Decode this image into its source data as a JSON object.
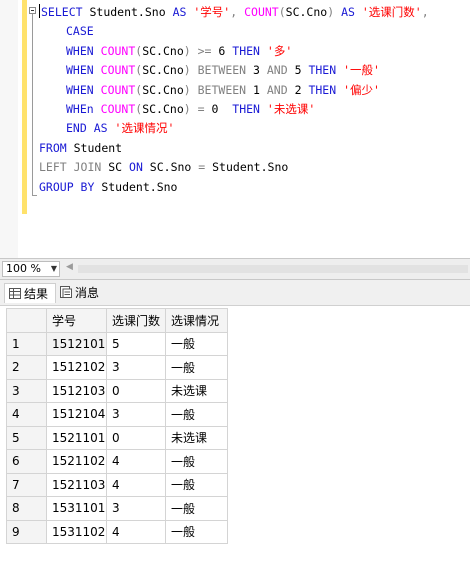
{
  "editor": {
    "lines": [
      [
        {
          "t": "kw",
          "v": "SELECT"
        },
        {
          "t": "txt",
          "v": " Student.Sno "
        },
        {
          "t": "kw",
          "v": "AS"
        },
        {
          "t": "txt",
          "v": " "
        },
        {
          "t": "str",
          "v": "'学号'"
        },
        {
          "t": "gr",
          "v": ","
        },
        {
          "t": "txt",
          "v": " "
        },
        {
          "t": "fn",
          "v": "COUNT"
        },
        {
          "t": "gr",
          "v": "("
        },
        {
          "t": "txt",
          "v": "SC.Cno"
        },
        {
          "t": "gr",
          "v": ")"
        },
        {
          "t": "txt",
          "v": " "
        },
        {
          "t": "kw",
          "v": "AS"
        },
        {
          "t": "txt",
          "v": " "
        },
        {
          "t": "str",
          "v": "'选课门数'"
        },
        {
          "t": "gr",
          "v": ","
        }
      ],
      [
        {
          "t": "kw",
          "v": "CASE"
        }
      ],
      [
        {
          "t": "kw",
          "v": "WHEN"
        },
        {
          "t": "txt",
          "v": " "
        },
        {
          "t": "fn",
          "v": "COUNT"
        },
        {
          "t": "gr",
          "v": "("
        },
        {
          "t": "txt",
          "v": "SC.Cno"
        },
        {
          "t": "gr",
          "v": ")"
        },
        {
          "t": "txt",
          "v": " "
        },
        {
          "t": "gr",
          "v": ">="
        },
        {
          "t": "txt",
          "v": " 6 "
        },
        {
          "t": "kw",
          "v": "THEN"
        },
        {
          "t": "txt",
          "v": " "
        },
        {
          "t": "str",
          "v": "'多'"
        }
      ],
      [
        {
          "t": "kw",
          "v": "WHEN"
        },
        {
          "t": "txt",
          "v": " "
        },
        {
          "t": "fn",
          "v": "COUNT"
        },
        {
          "t": "gr",
          "v": "("
        },
        {
          "t": "txt",
          "v": "SC.Cno"
        },
        {
          "t": "gr",
          "v": ")"
        },
        {
          "t": "txt",
          "v": " "
        },
        {
          "t": "gr",
          "v": "BETWEEN"
        },
        {
          "t": "txt",
          "v": " 3 "
        },
        {
          "t": "gr",
          "v": "AND"
        },
        {
          "t": "txt",
          "v": " 5 "
        },
        {
          "t": "kw",
          "v": "THEN"
        },
        {
          "t": "txt",
          "v": " "
        },
        {
          "t": "str",
          "v": "'一般'"
        }
      ],
      [
        {
          "t": "kw",
          "v": "WHEN"
        },
        {
          "t": "txt",
          "v": " "
        },
        {
          "t": "fn",
          "v": "COUNT"
        },
        {
          "t": "gr",
          "v": "("
        },
        {
          "t": "txt",
          "v": "SC.Cno"
        },
        {
          "t": "gr",
          "v": ")"
        },
        {
          "t": "txt",
          "v": " "
        },
        {
          "t": "gr",
          "v": "BETWEEN"
        },
        {
          "t": "txt",
          "v": " 1 "
        },
        {
          "t": "gr",
          "v": "AND"
        },
        {
          "t": "txt",
          "v": " 2 "
        },
        {
          "t": "kw",
          "v": "THEN"
        },
        {
          "t": "txt",
          "v": " "
        },
        {
          "t": "str",
          "v": "'偏少'"
        }
      ],
      [
        {
          "t": "kw",
          "v": "WHEn"
        },
        {
          "t": "txt",
          "v": " "
        },
        {
          "t": "fn",
          "v": "COUNT"
        },
        {
          "t": "gr",
          "v": "("
        },
        {
          "t": "txt",
          "v": "SC.Cno"
        },
        {
          "t": "gr",
          "v": ")"
        },
        {
          "t": "txt",
          "v": " "
        },
        {
          "t": "gr",
          "v": "="
        },
        {
          "t": "txt",
          "v": " 0  "
        },
        {
          "t": "kw",
          "v": "THEN"
        },
        {
          "t": "txt",
          "v": " "
        },
        {
          "t": "str",
          "v": "'未选课'"
        }
      ],
      [
        {
          "t": "kw",
          "v": "END"
        },
        {
          "t": "txt",
          "v": " "
        },
        {
          "t": "kw",
          "v": "AS"
        },
        {
          "t": "txt",
          "v": " "
        },
        {
          "t": "str",
          "v": "'选课情况'"
        }
      ],
      [
        {
          "t": "kw",
          "v": "FROM"
        },
        {
          "t": "txt",
          "v": " Student"
        }
      ],
      [
        {
          "t": "gr",
          "v": "LEFT JOIN"
        },
        {
          "t": "txt",
          "v": " SC "
        },
        {
          "t": "kw",
          "v": "ON"
        },
        {
          "t": "txt",
          "v": " SC.Sno "
        },
        {
          "t": "gr",
          "v": "="
        },
        {
          "t": "txt",
          "v": " Student.Sno"
        }
      ],
      [
        {
          "t": "kw",
          "v": "GROUP BY"
        },
        {
          "t": "txt",
          "v": " Student.Sno"
        }
      ]
    ],
    "indented_lines": [
      1,
      2,
      3,
      4,
      5,
      6
    ]
  },
  "zoom": {
    "value": "100 %"
  },
  "tabs": {
    "results": "结果",
    "messages": "消息"
  },
  "grid": {
    "headers": [
      "学号",
      "选课门数",
      "选课情况"
    ],
    "rows": [
      [
        "1",
        "1512101",
        "5",
        "一般"
      ],
      [
        "2",
        "1512102",
        "3",
        "一般"
      ],
      [
        "3",
        "1512103",
        "0",
        "未选课"
      ],
      [
        "4",
        "1512104",
        "3",
        "一般"
      ],
      [
        "5",
        "1521101",
        "0",
        "未选课"
      ],
      [
        "6",
        "1521102",
        "4",
        "一般"
      ],
      [
        "7",
        "1521103",
        "4",
        "一般"
      ],
      [
        "8",
        "1531101",
        "3",
        "一般"
      ],
      [
        "9",
        "1531102",
        "4",
        "一般"
      ]
    ]
  }
}
